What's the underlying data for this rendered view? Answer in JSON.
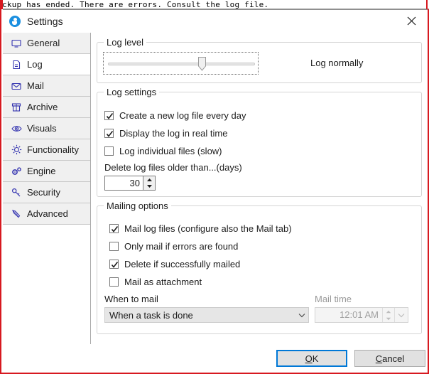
{
  "background": {
    "console_line": "ckup has ended. There are errors. Consult the log file."
  },
  "window": {
    "title": "Settings",
    "icon": "app-circle-icon",
    "close_label": "✕",
    "accent_color": "#0078d7",
    "frame_color": "#d71920"
  },
  "sidebar": {
    "items": [
      {
        "label": "General",
        "icon": "monitor-icon",
        "selected": false
      },
      {
        "label": "Log",
        "icon": "document-icon",
        "selected": true
      },
      {
        "label": "Mail",
        "icon": "envelope-icon",
        "selected": false
      },
      {
        "label": "Archive",
        "icon": "box-icon",
        "selected": false
      },
      {
        "label": "Visuals",
        "icon": "eye-icon",
        "selected": false
      },
      {
        "label": "Functionality",
        "icon": "sunburst-icon",
        "selected": false
      },
      {
        "label": "Engine",
        "icon": "gears-icon",
        "selected": false
      },
      {
        "label": "Security",
        "icon": "key-icon",
        "selected": false
      },
      {
        "label": "Advanced",
        "icon": "wrench-icon",
        "selected": false
      }
    ]
  },
  "log_level": {
    "group_title": "Log level",
    "slider_value_label": "Log normally",
    "slider_position_percent": 62
  },
  "log_settings": {
    "group_title": "Log settings",
    "checkboxes": [
      {
        "label": "Create a new log file every day",
        "checked": true
      },
      {
        "label": "Display the log in real time",
        "checked": true
      },
      {
        "label": "Log individual files (slow)",
        "checked": false
      }
    ],
    "delete_label": "Delete log files older than...(days)",
    "delete_days": "30"
  },
  "mailing_options": {
    "group_title": "Mailing options",
    "checkboxes": [
      {
        "label": "Mail log files (configure also the Mail tab)",
        "checked": true
      },
      {
        "label": "Only mail if errors are found",
        "checked": false
      },
      {
        "label": "Delete if successfully mailed",
        "checked": true
      },
      {
        "label": "Mail as attachment",
        "checked": false
      }
    ],
    "when_to_mail_label": "When to mail",
    "when_to_mail_value": "When a task is done",
    "mail_time_label": "Mail time",
    "mail_time_value": "12:01 AM",
    "mail_time_enabled": false
  },
  "footer": {
    "ok_label": "OK",
    "ok_accel": "O",
    "cancel_label": "Cancel",
    "cancel_accel": "C"
  }
}
